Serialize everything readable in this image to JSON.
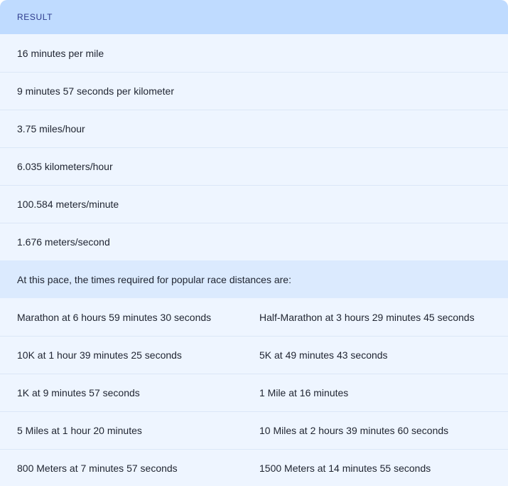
{
  "header": {
    "label": "RESULT"
  },
  "pace_results": [
    "16 minutes per mile",
    "9 minutes 57 seconds per kilometer",
    "3.75 miles/hour",
    "6.035 kilometers/hour",
    "100.584 meters/minute",
    "1.676 meters/second"
  ],
  "race_intro": "At this pace, the times required for popular race distances are:",
  "race_times": [
    [
      "Marathon at 6 hours 59 minutes 30 seconds",
      "Half-Marathon at 3 hours 29 minutes 45 seconds"
    ],
    [
      "10K at 1 hour 39 minutes 25 seconds",
      "5K at 49 minutes 43 seconds"
    ],
    [
      "1K at 9 minutes 57 seconds",
      "1 Mile at 16 minutes"
    ],
    [
      "5 Miles at 1 hour 20 minutes",
      "10 Miles at 2 hours 39 minutes 60 seconds"
    ],
    [
      "800 Meters at 7 minutes 57 seconds",
      "1500 Meters at 14 minutes 55 seconds"
    ]
  ],
  "colors": {
    "header_bg": "#bfdbff",
    "card_bg": "#eef5ff",
    "info_bg": "#dbeafe",
    "header_text": "#2d3a8c",
    "body_text": "#1f2430"
  }
}
